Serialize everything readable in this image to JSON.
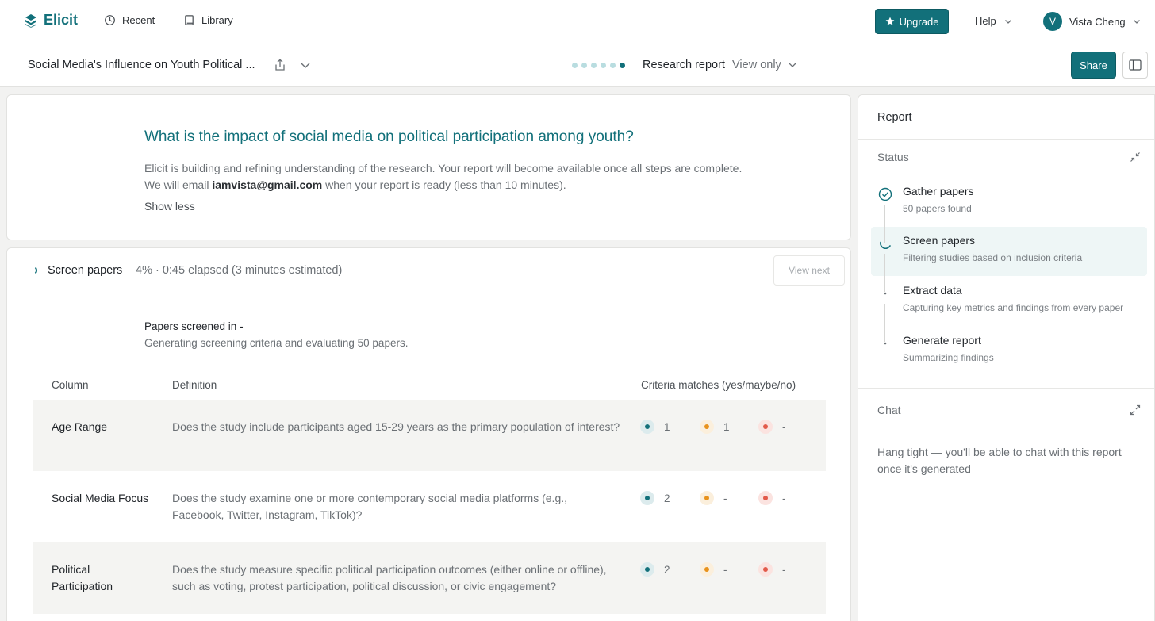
{
  "nav": {
    "brand": "Elicit",
    "recent": "Recent",
    "library": "Library",
    "upgrade": "Upgrade",
    "help": "Help",
    "user_initial": "V",
    "user_name": "Vista Cheng"
  },
  "subbar": {
    "doc_title": "Social Media's Influence on Youth Political ...",
    "progress_steps_total": 6,
    "progress_step_current": 6,
    "report_type": "Research report",
    "access": "View only",
    "share": "Share"
  },
  "question": {
    "title": "What is the impact of social media on political participation among youth?",
    "desc_before": "Elicit is building and refining understanding of the research. Your report will become available once all steps are complete. We will email ",
    "email": "iamvista@gmail.com",
    "desc_after": " when your report is ready (less than 10 minutes).",
    "show_less": "Show less"
  },
  "screen": {
    "title": "Screen papers",
    "meta": "4% · 0:45 elapsed (3 minutes estimated)",
    "view_next": "View next",
    "screened_label": "Papers screened in  -",
    "screened_sub": "Generating screening criteria and evaluating 50 papers.",
    "headers": {
      "column": "Column",
      "definition": "Definition",
      "matches": "Criteria matches (yes/maybe/no)"
    },
    "rows": [
      {
        "column": "Age Range",
        "definition": "Does the study include participants aged 15-29 years as the primary population of interest?",
        "yes": "1",
        "maybe": "1",
        "no": "-"
      },
      {
        "column": "Social Media Focus",
        "definition": "Does the study examine one or more contemporary social media platforms (e.g., Facebook, Twitter, Instagram, TikTok)?",
        "yes": "2",
        "maybe": "-",
        "no": "-"
      },
      {
        "column": "Political Participation",
        "definition": "Does the study measure specific political participation outcomes (either online or offline), such as voting, protest participation, political discussion, or civic engagement?",
        "yes": "2",
        "maybe": "-",
        "no": "-"
      }
    ]
  },
  "panel": {
    "title": "Report",
    "status_label": "Status",
    "steps": [
      {
        "title": "Gather papers",
        "sub": "50 papers found",
        "state": "done"
      },
      {
        "title": "Screen papers",
        "sub": "Filtering studies based on inclusion criteria",
        "state": "current"
      },
      {
        "title": "Extract data",
        "sub": "Capturing key metrics and findings from every paper",
        "state": "pending"
      },
      {
        "title": "Generate report",
        "sub": "Summarizing findings",
        "state": "pending"
      }
    ],
    "chat_label": "Chat",
    "chat_text": "Hang tight — you'll be able to chat with this report once it's generated"
  },
  "colors": {
    "accent": "#12707a",
    "yes": "#12707a",
    "maybe": "#e8921c",
    "no": "#e25a4a"
  }
}
